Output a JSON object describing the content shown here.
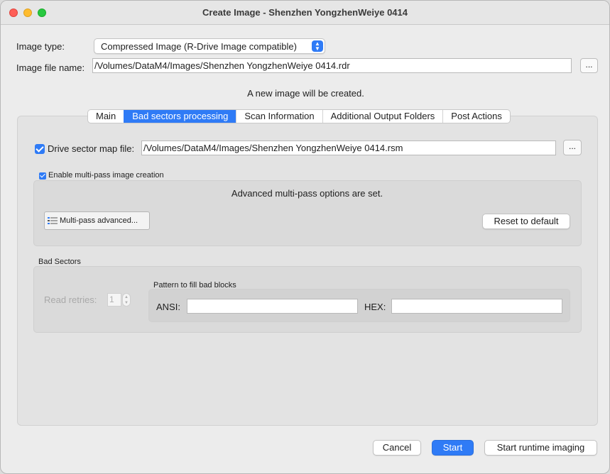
{
  "window": {
    "title": "Create Image - Shenzhen YongzhenWeiye 0414"
  },
  "form": {
    "image_type_label": "Image type:",
    "image_type_value": "Compressed Image (R-Drive Image compatible)",
    "image_file_label": "Image file name:",
    "image_file_value": "/Volumes/DataM4/Images/Shenzhen YongzhenWeiye 0414.rdr",
    "browse_label": "...",
    "status_message": "A new image will be created."
  },
  "tabs": [
    {
      "label": "Main"
    },
    {
      "label": "Bad sectors processing",
      "active": true
    },
    {
      "label": "Scan Information"
    },
    {
      "label": "Additional Output Folders"
    },
    {
      "label": "Post Actions"
    }
  ],
  "bad_sectors_tab": {
    "drive_map_label": "Drive sector map file:",
    "drive_map_checked": true,
    "drive_map_value": "/Volumes/DataM4/Images/Shenzhen YongzhenWeiye 0414.rsm",
    "browse_label": "...",
    "multipass_label": "Enable multi-pass image creation",
    "multipass_checked": true,
    "multipass_message": "Advanced multi-pass options are set.",
    "multipass_button": "Multi-pass advanced...",
    "reset_button": "Reset to default",
    "bad_sectors_heading": "Bad Sectors",
    "read_retries_label": "Read retries:",
    "read_retries_value": "1",
    "pattern_heading": "Pattern to fill bad blocks",
    "ansi_label": "ANSI:",
    "ansi_value": "",
    "hex_label": "HEX:",
    "hex_value": ""
  },
  "footer": {
    "cancel": "Cancel",
    "start": "Start",
    "start_runtime": "Start runtime imaging"
  },
  "colors": {
    "accent": "#2f7bf6",
    "close": "#fe5f57",
    "minimize": "#febc2e",
    "maximize": "#28c840"
  }
}
